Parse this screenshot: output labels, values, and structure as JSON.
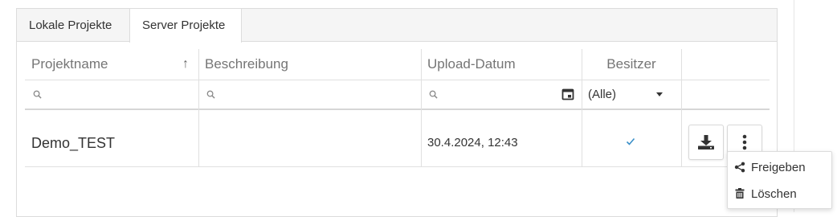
{
  "tabs": [
    {
      "label": "Lokale Projekte"
    },
    {
      "label": "Server Projekte"
    }
  ],
  "columns": {
    "name": "Projektname",
    "description": "Beschreibung",
    "upload_date": "Upload-Datum",
    "owner": "Besitzer"
  },
  "sort": {
    "column": "Projektname",
    "direction": "asc",
    "arrow": "↑"
  },
  "filters": {
    "owner_select_value": "(Alle)"
  },
  "rows": [
    {
      "name": "Demo_TEST",
      "description": "",
      "upload_date": "30.4.2024, 12:43",
      "owner_checked": true
    }
  ],
  "context_menu": {
    "items": [
      {
        "label": "Freigeben",
        "icon": "share-icon"
      },
      {
        "label": "Löschen",
        "icon": "trash-icon"
      }
    ]
  }
}
